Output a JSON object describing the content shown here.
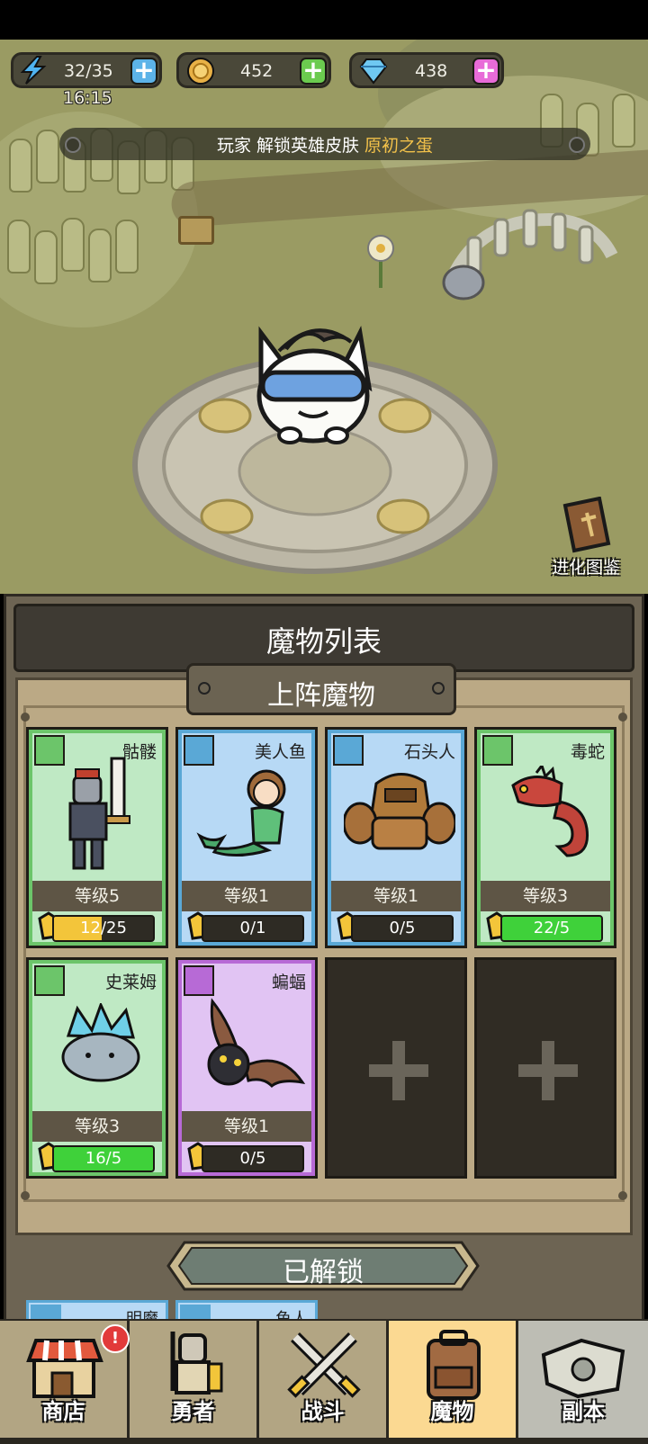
{
  "hud": {
    "energy": "32/35",
    "timer": "16:15",
    "coins": "452",
    "gems": "438"
  },
  "announcement": {
    "prefix": "玩家 解锁英雄皮肤",
    "highlight": "原初之蛋"
  },
  "evolution_book": {
    "label": "进化图鉴"
  },
  "panel": {
    "title": "魔物列表",
    "deployed_header": "上阵魔物",
    "unlocked_header": "已解锁"
  },
  "monsters": [
    {
      "name": "骷髅",
      "level": "等级5",
      "progress": "12/25",
      "fill": 0.48,
      "color": "#6cc56a",
      "bg": "#bfe9c4",
      "rarity": "green"
    },
    {
      "name": "美人鱼",
      "level": "等级1",
      "progress": "0/1",
      "fill": 0,
      "color": "#5aa8d6",
      "bg": "#b7d9f5",
      "rarity": "blue"
    },
    {
      "name": "石头人",
      "level": "等级1",
      "progress": "0/5",
      "fill": 0,
      "color": "#5aa8d6",
      "bg": "#b7d9f5",
      "rarity": "blue"
    },
    {
      "name": "毒蛇",
      "level": "等级3",
      "progress": "22/5",
      "fill": 1,
      "color": "#6cc56a",
      "bg": "#bfe9c4",
      "rarity": "green"
    },
    {
      "name": "史莱姆",
      "level": "等级3",
      "progress": "16/5",
      "fill": 1,
      "color": "#6cc56a",
      "bg": "#bfe9c4",
      "rarity": "green"
    },
    {
      "name": "蝙蝠",
      "level": "等级1",
      "progress": "0/5",
      "fill": 0,
      "color": "#b76ad6",
      "bg": "#e1c4f3",
      "rarity": "purple"
    }
  ],
  "unlocked_preview": [
    "明魔",
    "鱼人"
  ],
  "nav": [
    {
      "label": "商店",
      "badge": "!"
    },
    {
      "label": "勇者"
    },
    {
      "label": "战斗"
    },
    {
      "label": "魔物",
      "active": true
    },
    {
      "label": "副本"
    }
  ],
  "colors": {
    "energy_plus": "#5cb3e8",
    "coin_plus": "#6bcb4f",
    "gem_plus": "#e86bd8",
    "highlight": "#f2c14a",
    "progress_fill": "#3fd13a",
    "nav_active": "#fbd992"
  }
}
